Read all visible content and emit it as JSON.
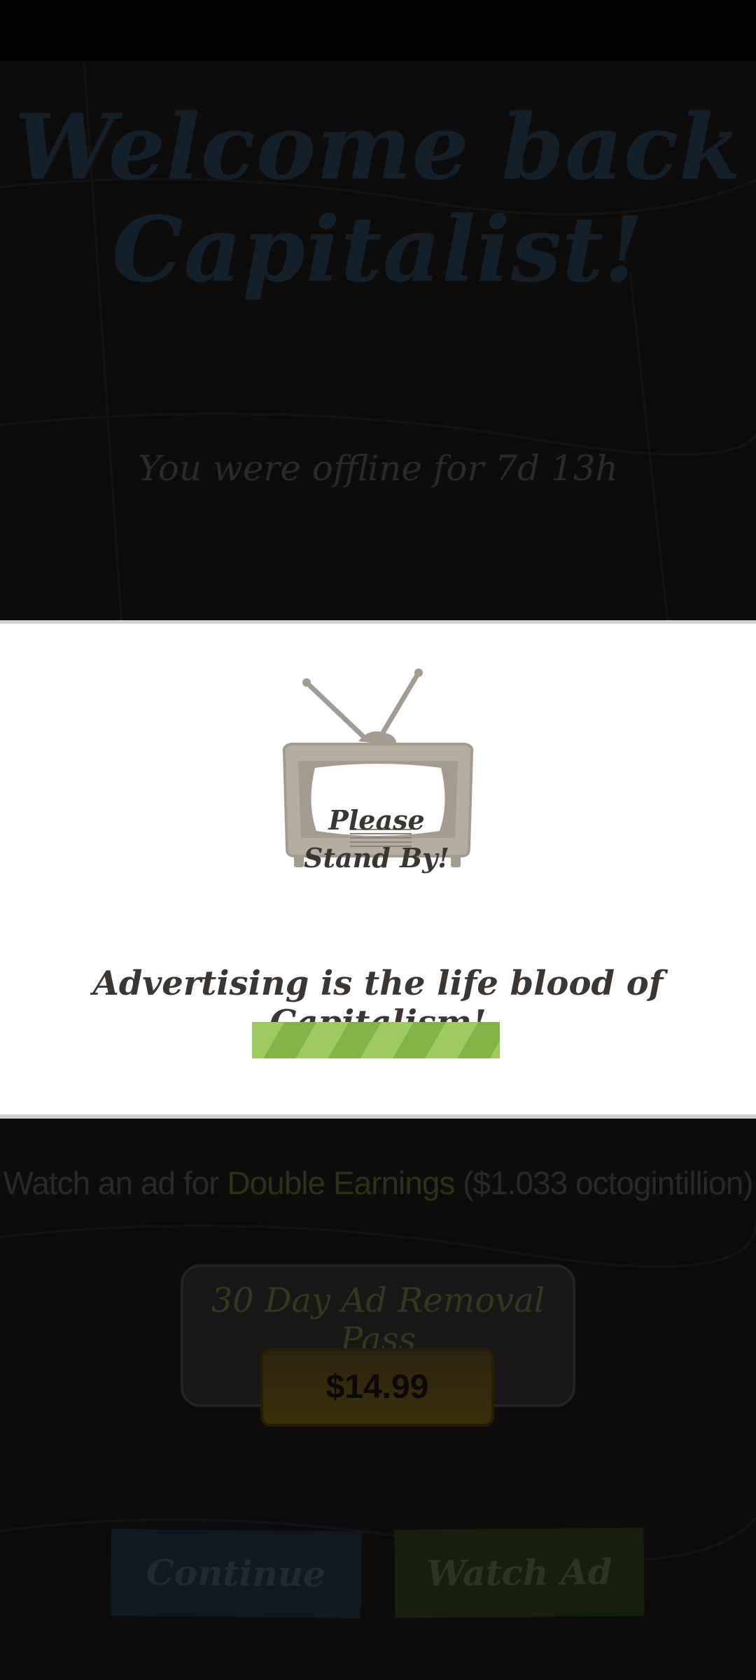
{
  "background": {
    "welcome_title_line1": "Welcome back",
    "welcome_title_line2": "Capitalist!",
    "offline_text": "You were offline for 7d 13h",
    "watch_prefix": "Watch an ad for ",
    "watch_accent": "Double Earnings",
    "watch_suffix": " ($1.033 octogintillion)",
    "pass_title": "30 Day Ad Removal Pass",
    "price_label": "$14.99",
    "continue_label": "Continue",
    "watch_ad_label": "Watch Ad"
  },
  "ad_overlay": {
    "tv_screen_line1": "Please",
    "tv_screen_line2": "Stand By!",
    "slogan": "Advertising is the life blood of Capitalism!",
    "tv_icon": "retro-tv-icon",
    "progress_indeterminate": true
  },
  "colors": {
    "overlay_bg": "#ffffff",
    "progress_light": "#9dcb62",
    "progress_dark": "#82b346",
    "slogan_text": "#3b3631"
  }
}
